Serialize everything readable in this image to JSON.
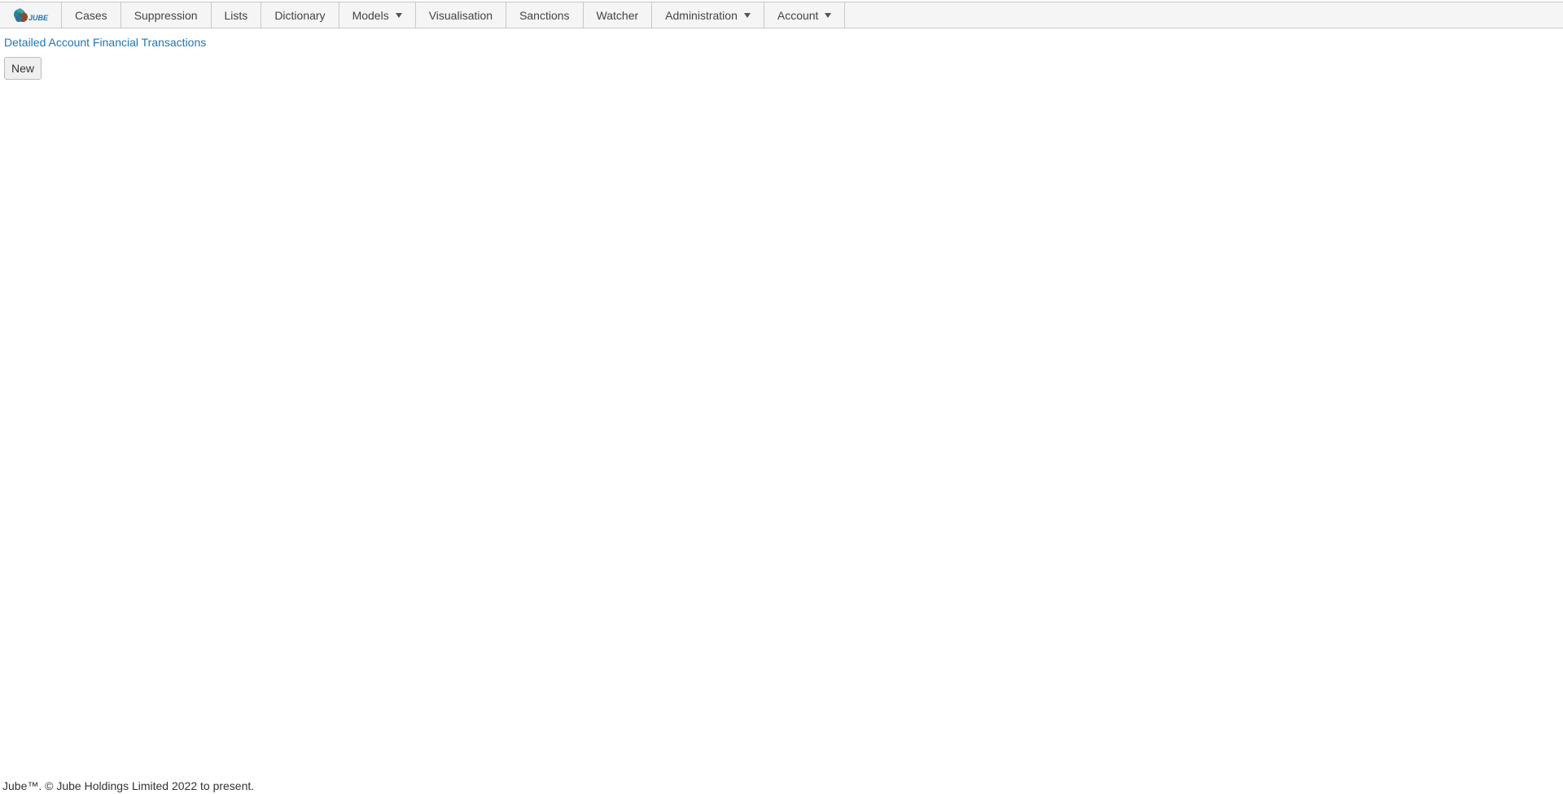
{
  "nav": {
    "logo_text": "JUBE",
    "items": [
      {
        "label": "Cases"
      },
      {
        "label": "Suppression"
      },
      {
        "label": "Lists"
      },
      {
        "label": "Dictionary"
      },
      {
        "label": "Models"
      },
      {
        "label": "Visualisation"
      },
      {
        "label": "Sanctions"
      },
      {
        "label": "Watcher"
      },
      {
        "label": "Administration"
      },
      {
        "label": "Account"
      }
    ]
  },
  "main": {
    "report_link": "Detailed Account Financial Transactions",
    "new_button": "New"
  },
  "footer": {
    "text": "Jube™. © Jube Holdings Limited 2022 to present."
  },
  "colors": {
    "link": "#1f76b7",
    "logo_teal": "#1a8c95",
    "logo_brown": "#8a4b2e"
  }
}
